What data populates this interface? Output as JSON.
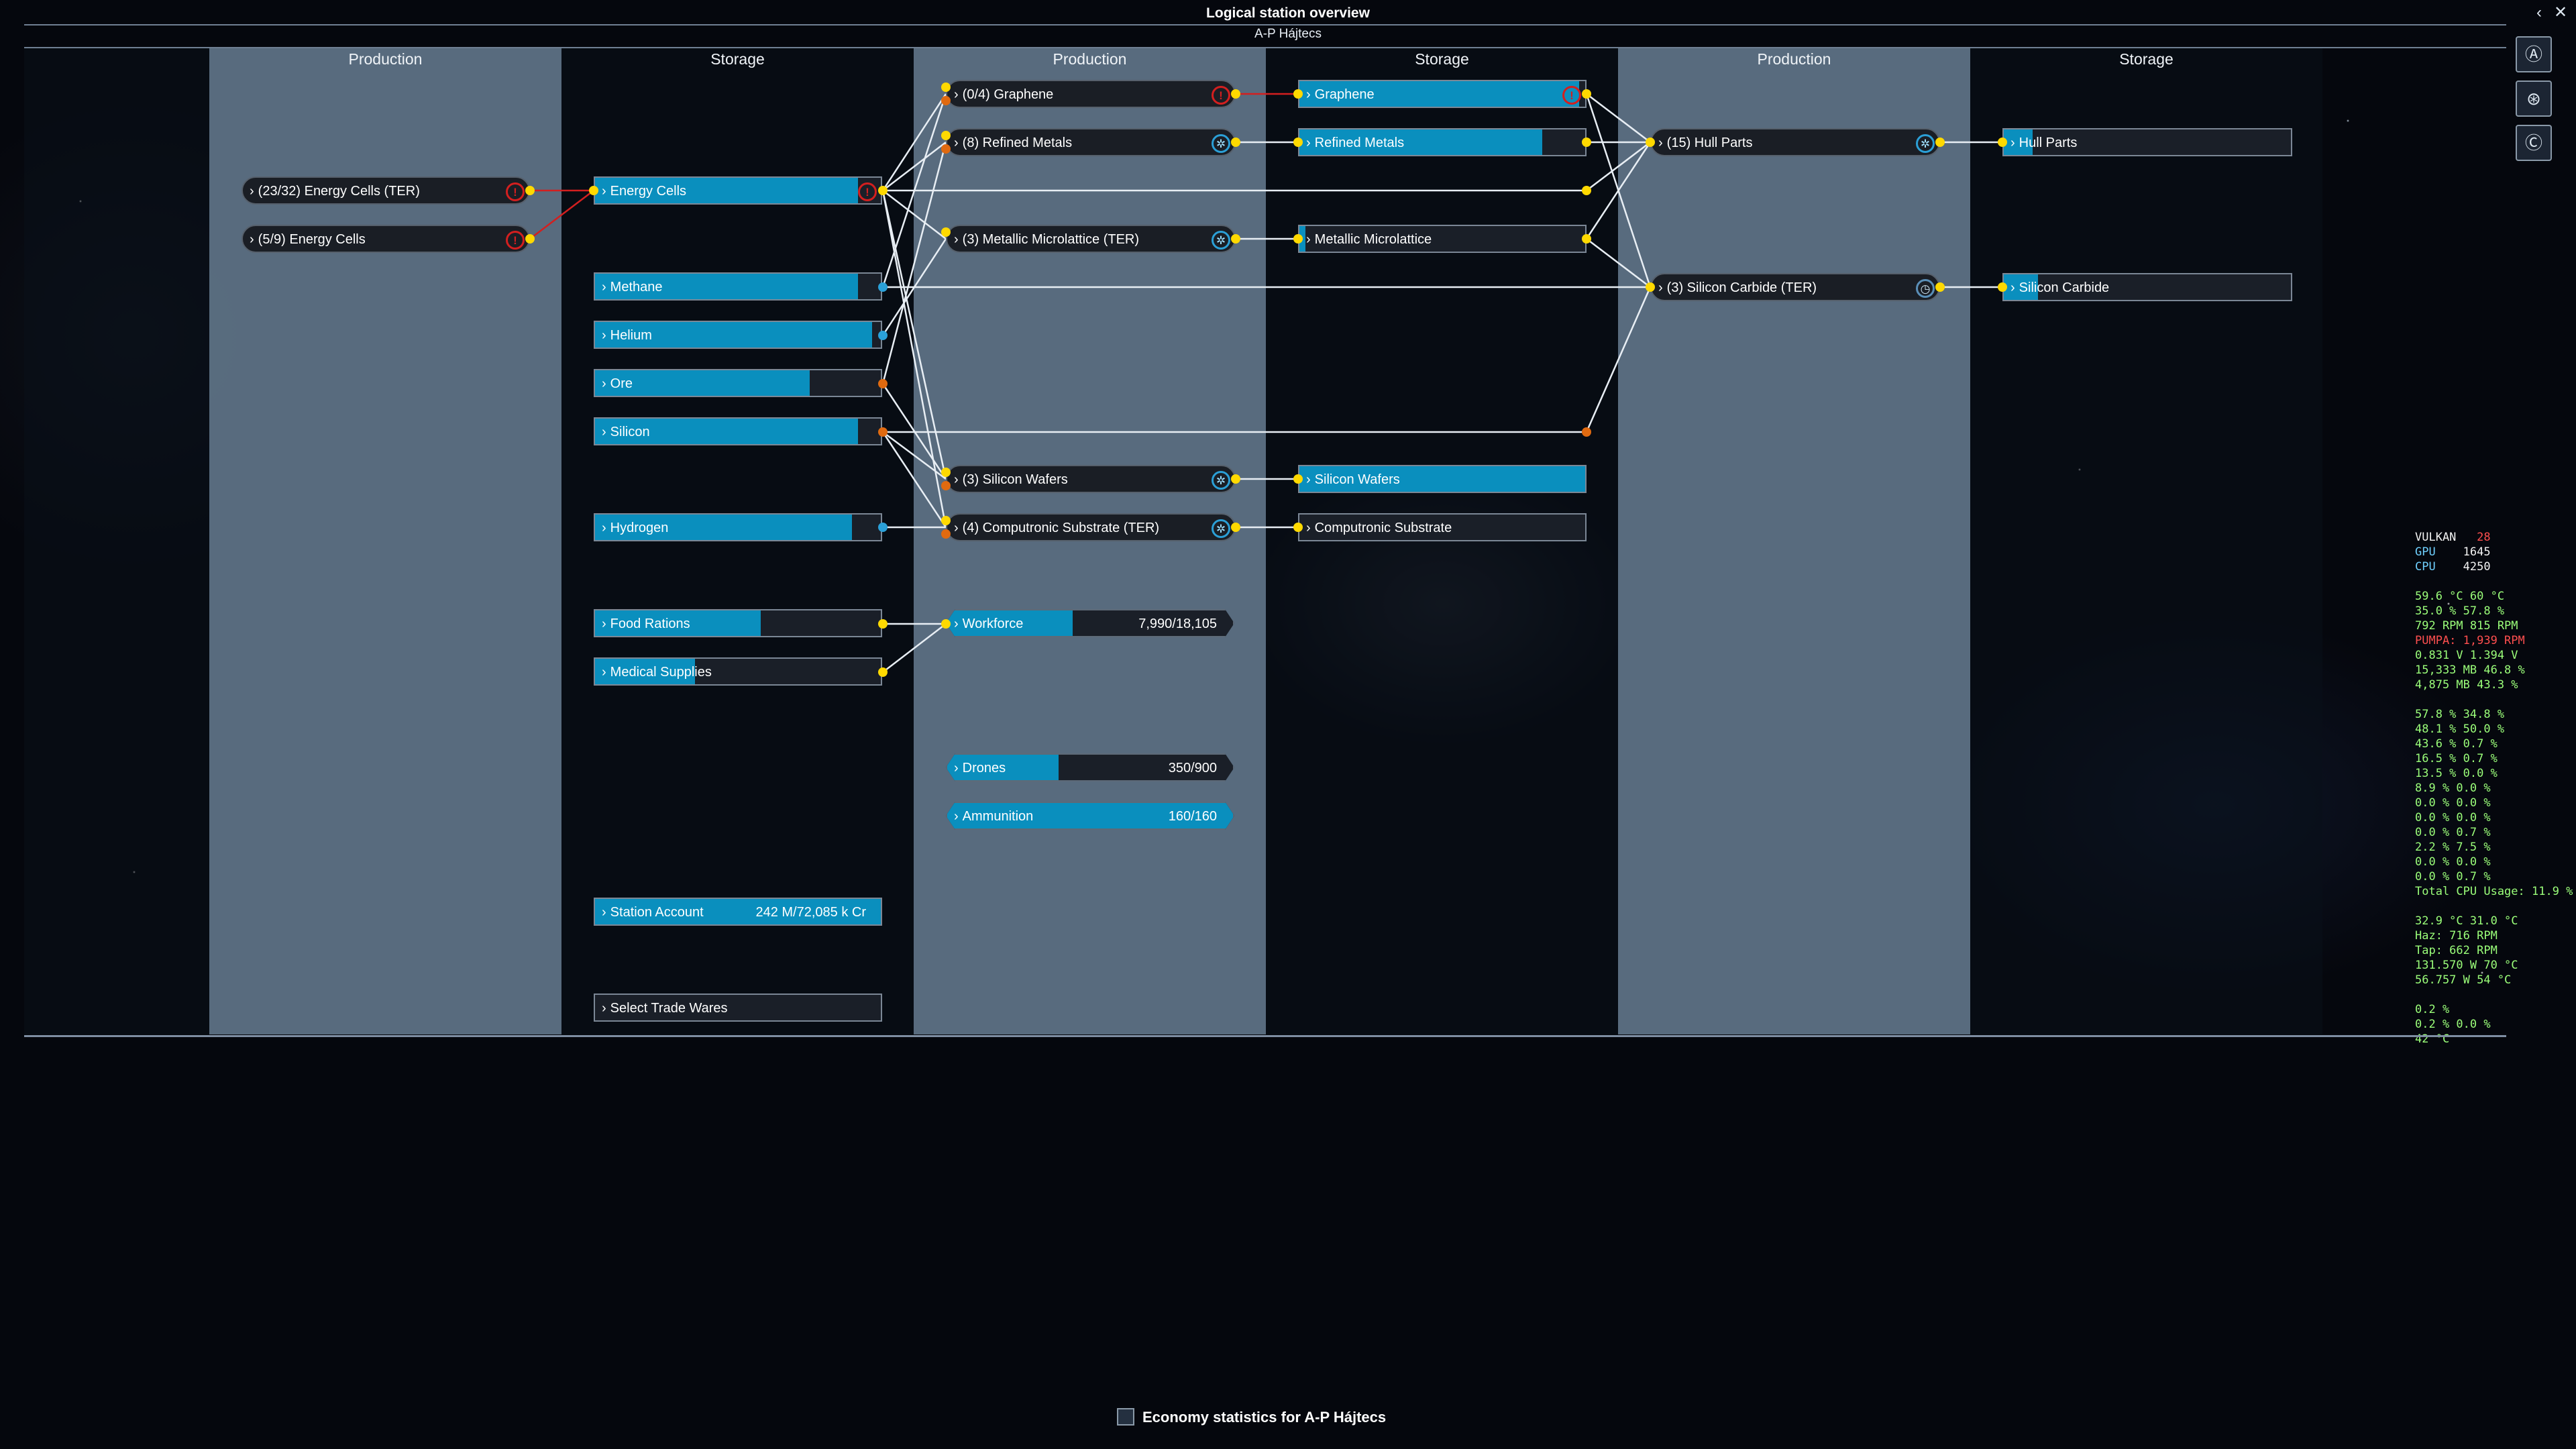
{
  "window": {
    "title": "Logical station overview",
    "subtitle": "A-P Hájtecs",
    "back_label": "‹",
    "close_label": "✕"
  },
  "columns": [
    "Production",
    "Storage",
    "Production",
    "Storage",
    "Production",
    "Storage"
  ],
  "col1": [
    {
      "label": "(23/32) Energy Cells (TER)",
      "status": "warning"
    },
    {
      "label": "(5/9) Energy Cells",
      "status": "warning"
    }
  ],
  "col2": [
    {
      "label": "Energy Cells",
      "fill": 0.92,
      "status": "warning"
    },
    {
      "label": "Methane",
      "fill": 0.92
    },
    {
      "label": "Helium",
      "fill": 0.97
    },
    {
      "label": "Ore",
      "fill": 0.75
    },
    {
      "label": "Silicon",
      "fill": 0.92
    },
    {
      "label": "Hydrogen",
      "fill": 0.9
    },
    {
      "label": "Food Rations",
      "fill": 0.58
    },
    {
      "label": "Medical Supplies",
      "fill": 0.35
    }
  ],
  "account": {
    "label": "Station Account",
    "value": "242 M/72,085 k Cr"
  },
  "trade": {
    "label": "Select Trade Wares"
  },
  "col3": [
    {
      "label": "(0/4) Graphene",
      "status": "warning"
    },
    {
      "label": "(8) Refined Metals",
      "status": "working"
    },
    {
      "label": "(3) Metallic Microlattice (TER)",
      "status": "working"
    },
    {
      "label": "(3) Silicon Wafers",
      "status": "working"
    },
    {
      "label": "(4) Computronic Substrate (TER)",
      "status": "working"
    }
  ],
  "resources": {
    "workforce": {
      "label": "Workforce",
      "value": "7,990/18,105",
      "fill": 0.44
    },
    "drones": {
      "label": "Drones",
      "value": "350/900",
      "fill": 0.39
    },
    "ammunition": {
      "label": "Ammunition",
      "value": "160/160",
      "fill": 1.0
    }
  },
  "col4": [
    {
      "label": "Graphene",
      "fill": 0.98,
      "status": "warning"
    },
    {
      "label": "Refined Metals",
      "fill": 0.85
    },
    {
      "label": "Metallic Microlattice",
      "fill": 0.02
    },
    {
      "label": "Silicon Wafers",
      "fill": 1.0
    },
    {
      "label": "Computronic Substrate",
      "fill": 0.0
    }
  ],
  "col5": [
    {
      "label": "(15) Hull Parts",
      "status": "working"
    },
    {
      "label": "(3) Silicon Carbide (TER)",
      "status": "idle"
    }
  ],
  "col6": [
    {
      "label": "Hull Parts",
      "fill": 0.1
    },
    {
      "label": "Silicon Carbide",
      "fill": 0.12
    }
  ],
  "right_buttons": [
    {
      "name": "autopilot-icon",
      "glyph": "Ⓐ"
    },
    {
      "name": "map-icon",
      "glyph": "⊛"
    },
    {
      "name": "comm-icon",
      "glyph": "Ⓒ"
    }
  ],
  "perf_overlay": {
    "api": "VULKAN",
    "fps": "28",
    "gpu_label": "GPU",
    "gpu_mhz": "1645",
    "cpu_label": "CPU",
    "cpu_mhz": "4250",
    "lines_a": [
      "59.6 °C 60 °C",
      "35.0 % 57.8 %",
      "792 RPM 815 RPM"
    ],
    "pump": "PUMPA: 1,939 RPM",
    "lines_b": [
      "0.831 V 1.394 V",
      "15,333 MB 46.8 %",
      "4,875 MB 43.3 %"
    ],
    "cores": [
      "57.8 % 34.8 %",
      "48.1 % 50.0 %",
      "43.6 % 0.7 %",
      "16.5 % 0.7 %",
      "13.5 % 0.0 %",
      "8.9 % 0.0 %",
      "0.0 % 0.0 %",
      "0.0 % 0.0 %",
      "0.0 % 0.7 %",
      "2.2 % 7.5 %",
      "0.0 % 0.0 %",
      "0.0 % 0.7 %"
    ],
    "total": "Total CPU Usage: 11.9 %",
    "lines_c": [
      "32.9 °C 31.0 °C",
      "Haz: 716 RPM",
      "Tap: 662 RPM",
      "131.570 W 70 °C",
      "56.757 W 54 °C"
    ],
    "lines_d": [
      "0.2 %",
      "0.2 % 0.0 %",
      "42 °C"
    ]
  },
  "footer": {
    "label": "Economy statistics for A-P Hájtecs"
  },
  "colors": {
    "accent": "#0a8fbe",
    "warning": "#d31f1f",
    "connector": "#ffd900",
    "panel": "#607488"
  }
}
